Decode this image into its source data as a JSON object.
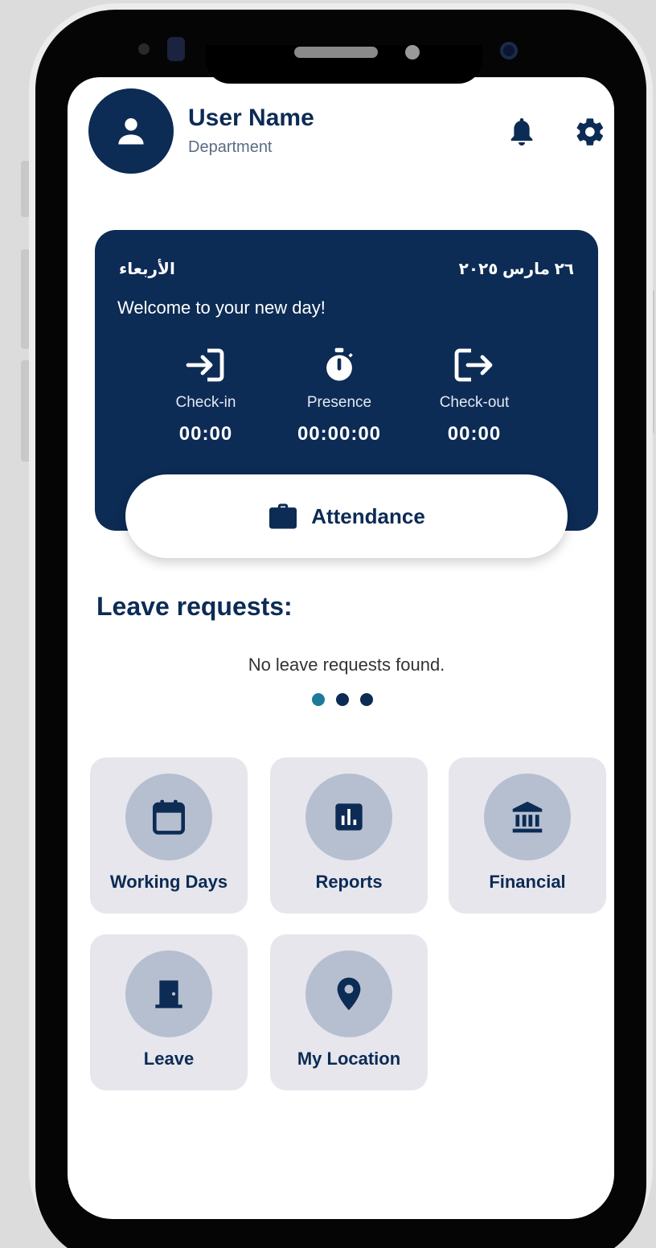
{
  "header": {
    "user_name": "User Name",
    "department": "Department",
    "icons": {
      "avatar": "person-icon",
      "notifications": "bell-icon",
      "settings": "gear-icon"
    }
  },
  "day_card": {
    "day_name": "الأربعاء",
    "date": "٢٦ مارس ٢٠٢٥",
    "welcome": "Welcome to your new day!",
    "stats": [
      {
        "label": "Check-in",
        "value": "00:00",
        "icon": "login-icon"
      },
      {
        "label": "Presence",
        "value": "00:00:00",
        "icon": "stopwatch-icon"
      },
      {
        "label": "Check-out",
        "value": "00:00",
        "icon": "logout-icon"
      }
    ]
  },
  "attendance_button": {
    "label": "Attendance",
    "icon": "briefcase-icon"
  },
  "leave_requests": {
    "title": "Leave requests:",
    "empty_text": "No leave requests found.",
    "pager": {
      "pages": 3,
      "active": 1
    }
  },
  "menu": [
    {
      "label": "Working Days",
      "icon": "calendar-icon"
    },
    {
      "label": "Reports",
      "icon": "report-chart-icon"
    },
    {
      "label": "Financial",
      "icon": "bank-icon"
    },
    {
      "label": "Leave",
      "icon": "door-icon"
    },
    {
      "label": "My Location",
      "icon": "location-pin-icon"
    }
  ],
  "colors": {
    "primary": "#0c2b55",
    "tile_bg": "#e6e6ec",
    "tile_circle": "#b6bfd0",
    "dot_active": "#1d7a9a"
  }
}
